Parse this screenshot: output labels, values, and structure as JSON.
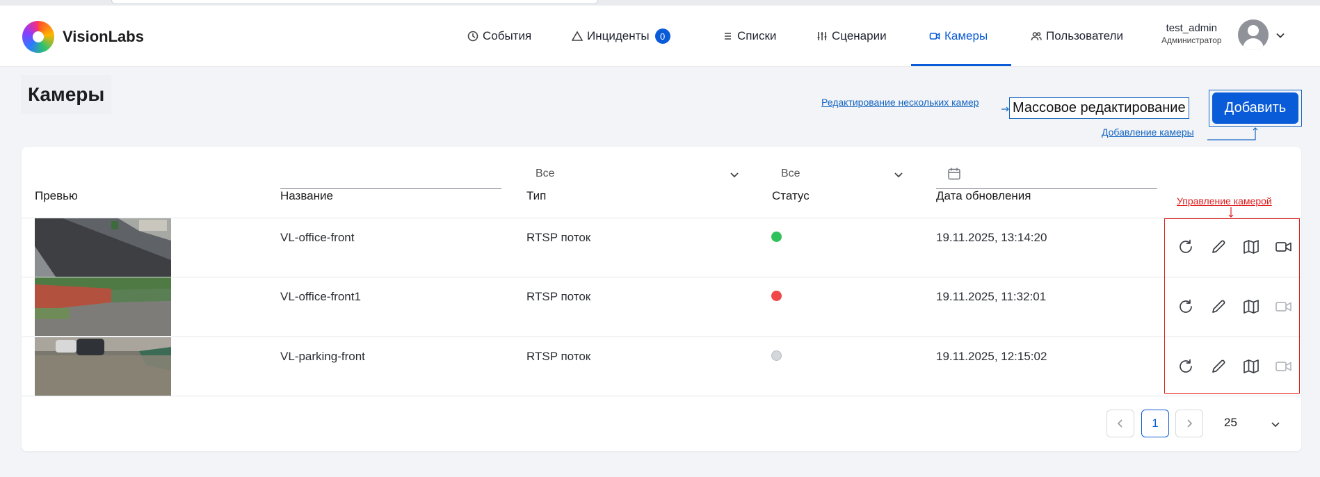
{
  "app": {
    "logo_text": "VisionLabs"
  },
  "nav": [
    {
      "label": "События",
      "icon": "clock-icon"
    },
    {
      "label": "Инциденты",
      "icon": "warning-icon",
      "badge": "0"
    },
    {
      "label": "Списки",
      "icon": "list-icon"
    },
    {
      "label": "Сценарии",
      "icon": "sliders-icon"
    },
    {
      "label": "Камеры",
      "icon": "video-camera-icon",
      "active": true
    },
    {
      "label": "Пользователи",
      "icon": "users-icon"
    }
  ],
  "user": {
    "name": "test_admin",
    "role": "Администратор"
  },
  "page": {
    "title": "Камеры",
    "mass_edit_label": "Массовое редактирование",
    "add_label": "Добавить"
  },
  "annotations": {
    "mass_edit": "Редактирование нескольких камер",
    "add": "Добавление камеры",
    "manage": "Управление камерой"
  },
  "table": {
    "columns": [
      "Превью",
      "Название",
      "Тип",
      "Статус",
      "Дата обновления"
    ],
    "filters": {
      "type": "Все",
      "status": "Все"
    },
    "rows": [
      {
        "name": "VL-office-front",
        "type": "RTSP поток",
        "status": "online",
        "updated": "19.11.2025, 13:14:20",
        "video_enabled": true
      },
      {
        "name": "VL-office-front1",
        "type": "RTSP поток",
        "status": "error",
        "updated": "19.11.2025, 11:32:01",
        "video_enabled": false
      },
      {
        "name": "VL-parking-front",
        "type": "RTSP поток",
        "status": "unknown",
        "updated": "19.11.2025, 12:15:02",
        "video_enabled": false
      }
    ],
    "status_colors": {
      "online": "#2fc25b",
      "error": "#f04848",
      "unknown": "#d3d6da"
    }
  },
  "pagination": {
    "current_page": "1",
    "page_size": "25"
  },
  "colors": {
    "accent": "#0a5bd8",
    "annotation_blue": "#1565c0",
    "annotation_red": "#e01b1b"
  }
}
